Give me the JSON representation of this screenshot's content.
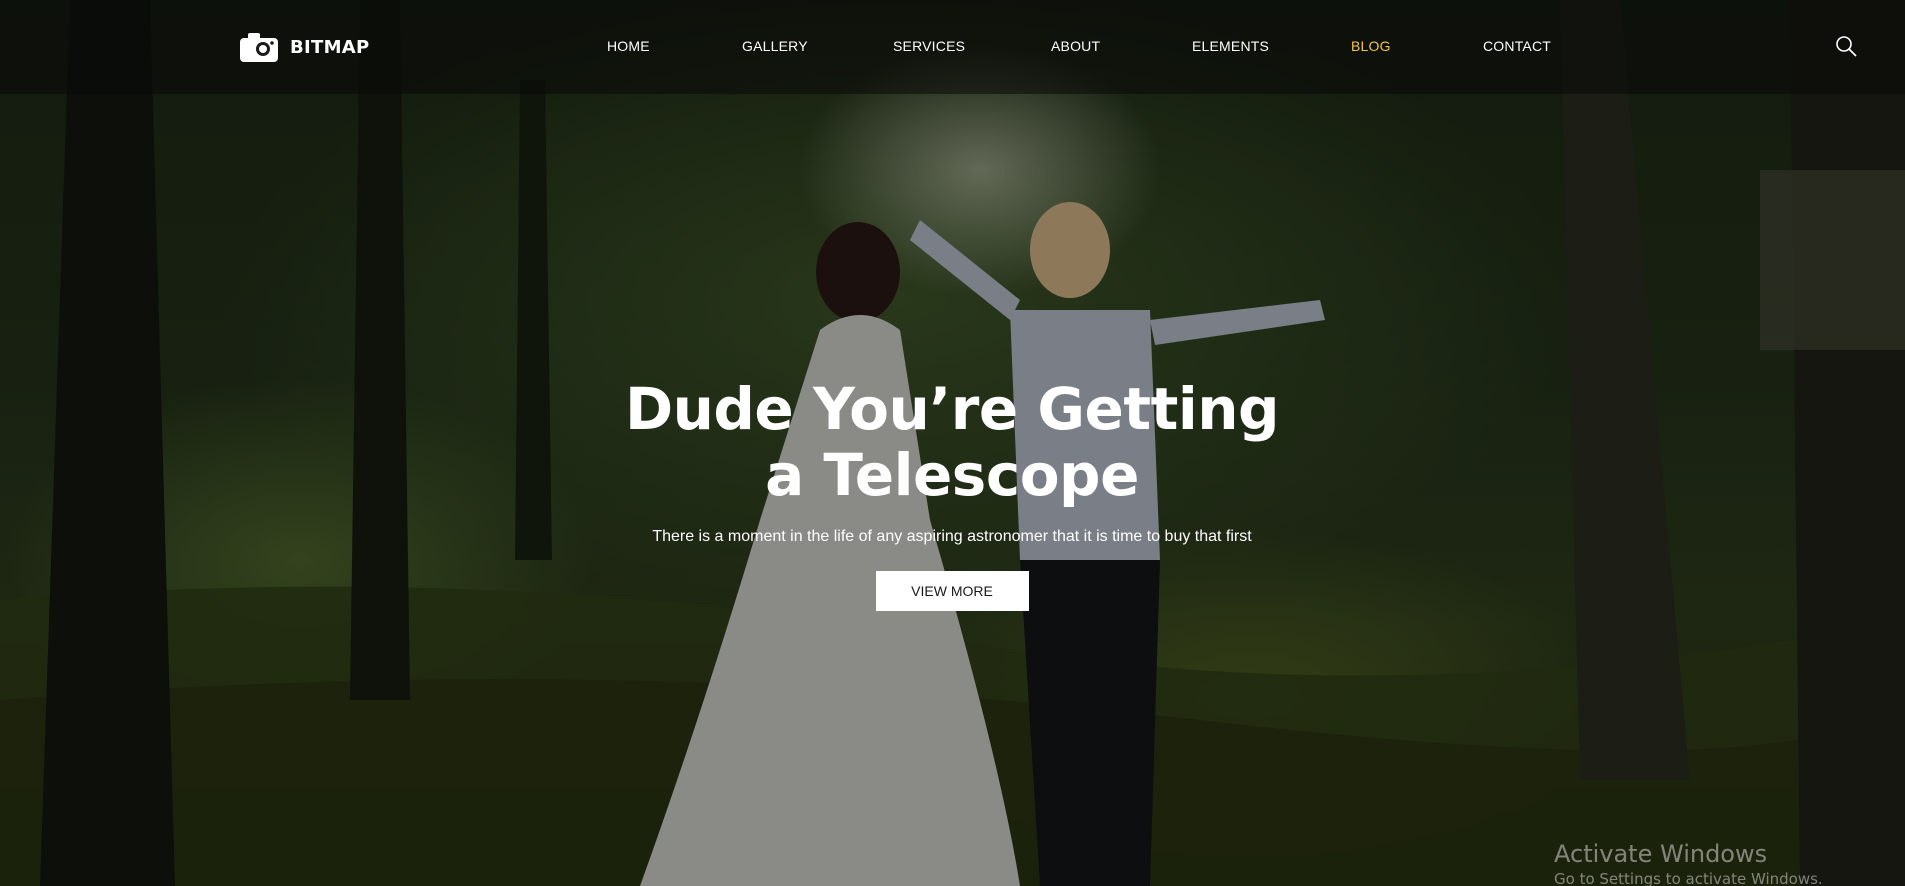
{
  "brand": {
    "name": "BITMAP"
  },
  "nav": {
    "items": [
      {
        "label": "HOME",
        "active": false
      },
      {
        "label": "GALLERY",
        "active": false
      },
      {
        "label": "SERVICES",
        "active": false
      },
      {
        "label": "ABOUT",
        "active": false
      },
      {
        "label": "ELEMENTS",
        "active": false
      },
      {
        "label": "BLOG",
        "active": true
      },
      {
        "label": "CONTACT",
        "active": false
      }
    ],
    "search_icon": "search-icon"
  },
  "hero": {
    "title_line1": "Dude You’re Getting",
    "title_line2": "a Telescope",
    "subtitle": "There is a moment in the life of any aspiring astronomer that it is time to buy that first",
    "button_label": "VIEW MORE"
  },
  "watermark": {
    "title": "Activate Windows",
    "subtitle": "Go to Settings to activate Windows."
  },
  "colors": {
    "active_nav": "#f4c542",
    "button_bg": "#ffffff",
    "text": "#ffffff"
  }
}
